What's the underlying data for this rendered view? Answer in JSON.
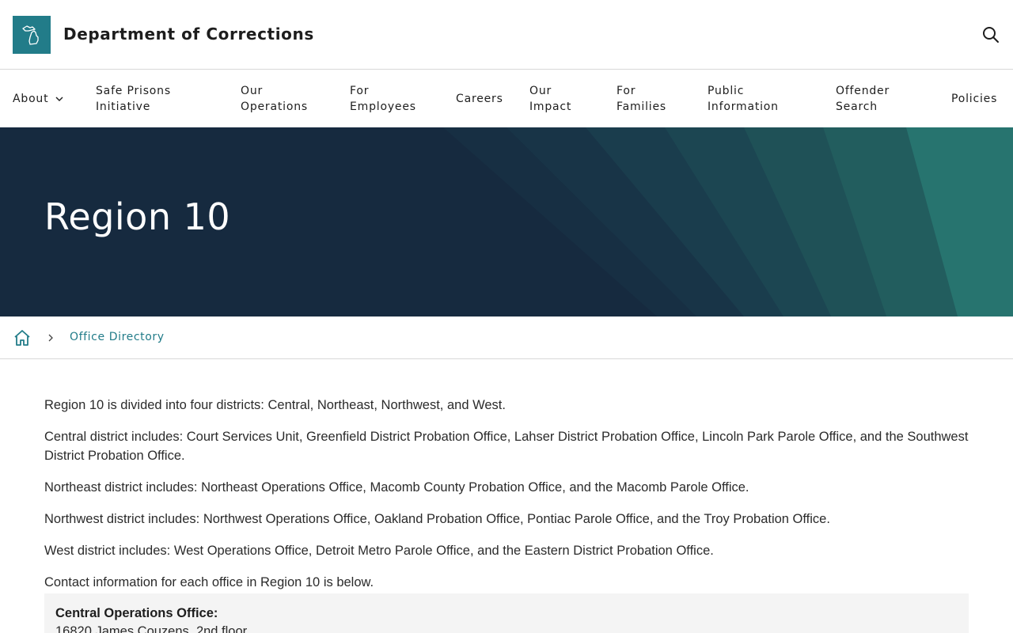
{
  "header": {
    "title": "Department of Corrections",
    "logo_icon": "michigan-map-icon",
    "search_icon": "search-icon"
  },
  "nav": {
    "items": [
      {
        "label": "About",
        "has_dropdown": true
      },
      {
        "label": "Safe Prisons\nInitiative"
      },
      {
        "label": "Our\nOperations"
      },
      {
        "label": "For\nEmployees"
      },
      {
        "label": "Careers"
      },
      {
        "label": "Our\nImpact"
      },
      {
        "label": "For\nFamilies"
      },
      {
        "label": "Public\nInformation"
      },
      {
        "label": "Offender\nSearch"
      },
      {
        "label": "Policies"
      }
    ]
  },
  "hero": {
    "title": "Region 10",
    "bg_color": "#162a3f",
    "accent_color": "#2a8a85"
  },
  "breadcrumb": {
    "home_icon": "home-icon",
    "separator_icon": "chevron-right-icon",
    "link": "Office Directory"
  },
  "content": {
    "paragraphs": [
      "Region 10 is divided into four districts: Central, Northeast, Northwest, and West.",
      "Central district includes: Court Services Unit, Greenfield District Probation Office, Lahser District Probation Office, Lincoln Park Parole Office, and the Southwest District Probation Office.",
      "Northeast district includes: Northeast Operations Office, Macomb County Probation Office, and the Macomb Parole Office.",
      "Northwest district includes: Northwest Operations Office, Oakland Probation Office, Pontiac Parole Office, and the Troy Probation Office.",
      "West district includes: West Operations Office, Detroit Metro Parole Office, and the Eastern District Probation Office.",
      "Contact information for each office in Region 10 is below."
    ],
    "office": {
      "name": "Central Operations Office:",
      "address": "16820 James Couzens, 2nd floor"
    }
  },
  "colors": {
    "brand_teal": "#227c89",
    "link": "#227c89"
  }
}
